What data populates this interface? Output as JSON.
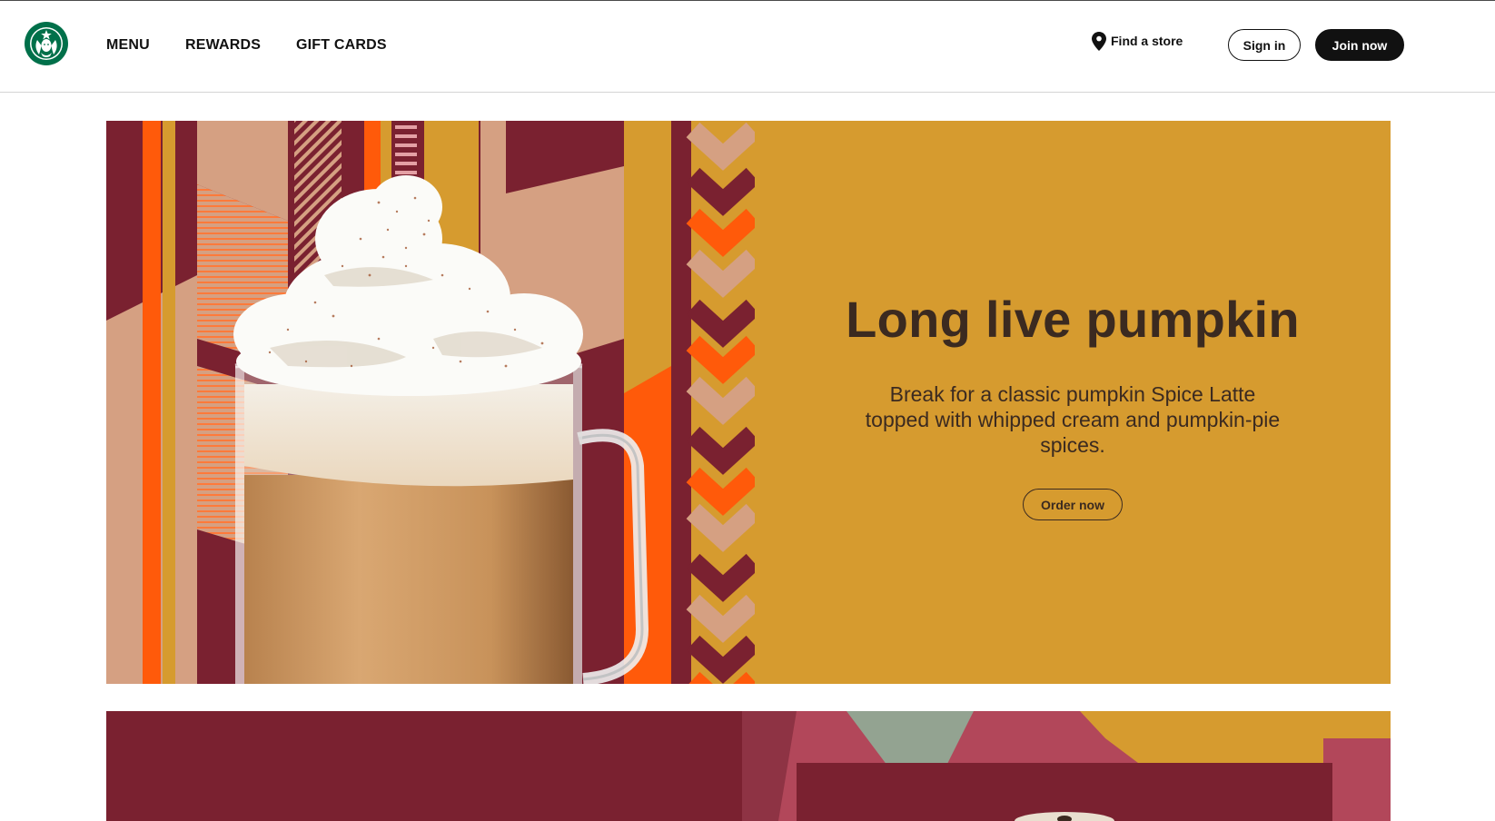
{
  "header": {
    "logo_alt": "Starbucks",
    "nav": [
      {
        "label": "MENU"
      },
      {
        "label": "REWARDS"
      },
      {
        "label": "GIFT CARDS"
      }
    ],
    "find_store": "Find a store",
    "sign_in": "Sign in",
    "join_now": "Join now"
  },
  "hero": {
    "title": "Long live pumpkin",
    "body": "Break for a classic pumpkin Spice Latte topped with whipped cream and pumpkin-pie spices.",
    "cta": "Order now",
    "panel_color": "#d69b2f",
    "image_icon": "pumpkin-spice-latte-image"
  },
  "colors": {
    "maroon": "#7a2130",
    "orange": "#ff5a0a",
    "gold": "#d69b2f",
    "peach": "#d5a082",
    "brand_green": "#00704a"
  }
}
